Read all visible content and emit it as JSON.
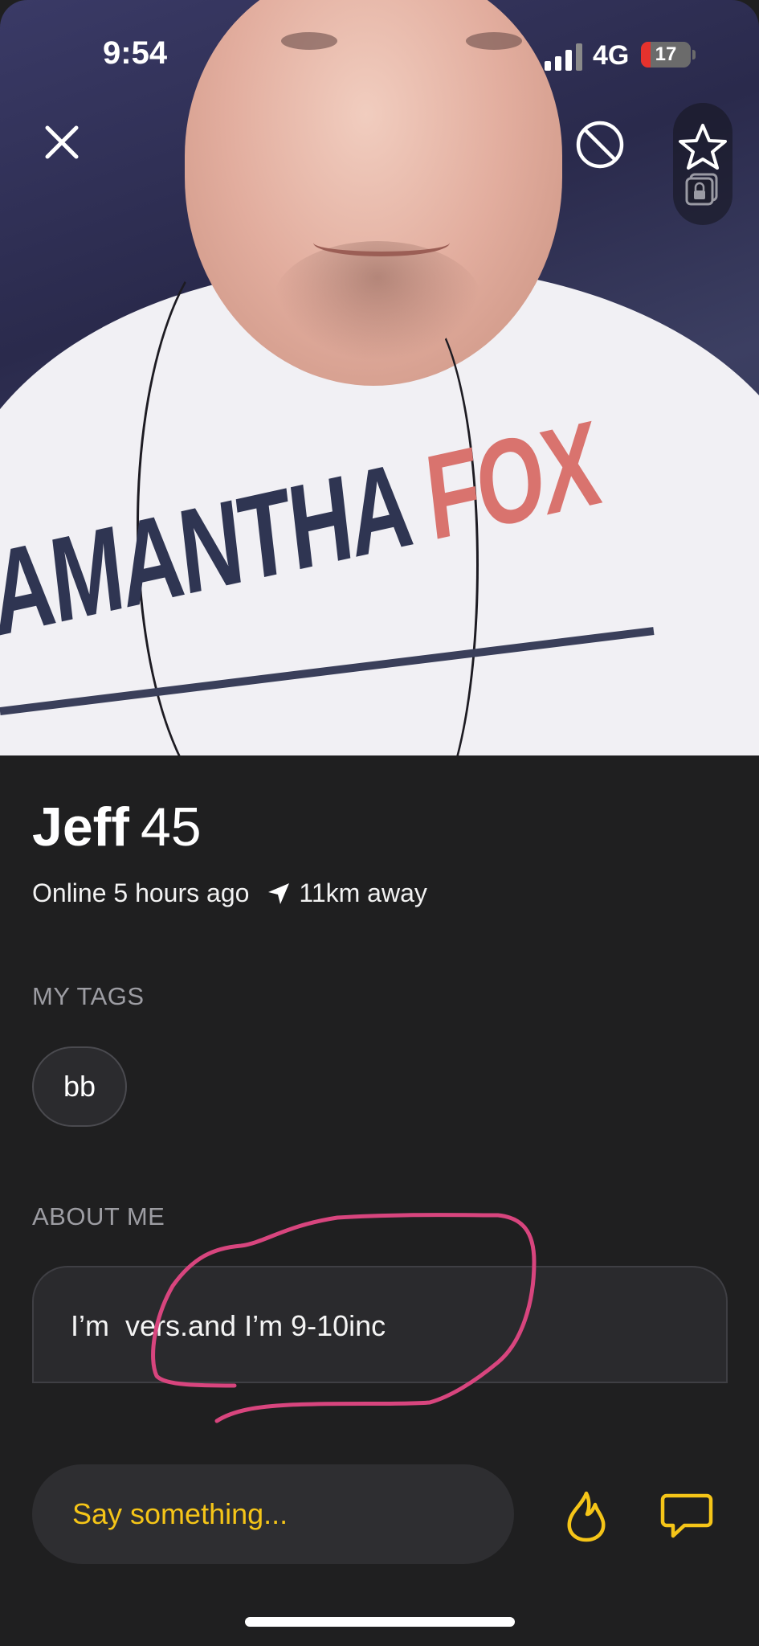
{
  "status_bar": {
    "time": "9:54",
    "network": "4G",
    "battery": "17",
    "battery_level_percent": 17,
    "signal_bars_active": 3
  },
  "photo_controls": {
    "close_icon": "close-icon",
    "block_icon": "block-icon",
    "favorite_icon": "star-icon",
    "private_album_icon": "lock-album-icon"
  },
  "photo_text": {
    "shirt_main": "AMANTHA ",
    "shirt_accent": "FOX"
  },
  "profile": {
    "name": "Jeff",
    "age": "45",
    "online_status": "Online 5 hours ago",
    "distance": "11km away"
  },
  "tags_section": {
    "label": "MY TAGS",
    "tags": [
      "bb"
    ]
  },
  "about_section": {
    "label": "ABOUT ME",
    "text": "I’m  vers.and I’m 9-10inc"
  },
  "message_bar": {
    "placeholder": "Say something...",
    "tap_icon": "flame-icon",
    "chat_icon": "chat-icon"
  },
  "colors": {
    "background": "#1f1f20",
    "accent": "#f5c518",
    "annotation": "#d8457e"
  }
}
